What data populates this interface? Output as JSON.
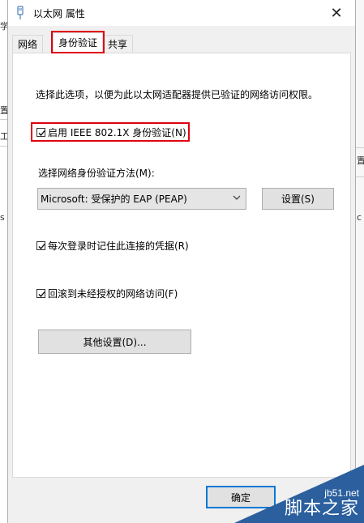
{
  "window": {
    "title": "以太网 属性",
    "close_glyph": "✕"
  },
  "tabs": [
    {
      "label": "网络",
      "active": false
    },
    {
      "label": "身份验证",
      "active": true
    },
    {
      "label": "共享",
      "active": false
    }
  ],
  "auth": {
    "description": "选择此选项，以便为此以太网适配器提供已验证的网络访问权限。",
    "enable_8021x": {
      "label": "启用 IEEE 802.1X 身份验证(N)",
      "checked": true
    },
    "method_label": "选择网络身份验证方法(M):",
    "method_selected": "Microsoft: 受保护的 EAP (PEAP)",
    "settings_button": "设置(S)",
    "remember_credentials": {
      "label": "每次登录时记住此连接的凭据(R)",
      "checked": true
    },
    "fallback_unauthorized": {
      "label": "回滚到未经授权的网络访问(F)",
      "checked": true
    },
    "advanced_button": "其他设置(D)..."
  },
  "footer": {
    "ok_button": "确定"
  },
  "background_fragments": {
    "left": [
      "学",
      "置",
      "工",
      "s"
    ],
    "right": [
      "置",
      "c"
    ]
  },
  "watermark": {
    "url": "jb51.net",
    "text": "脚本之家"
  },
  "colors": {
    "highlight": "#e0000f",
    "focus": "#0078d7"
  }
}
